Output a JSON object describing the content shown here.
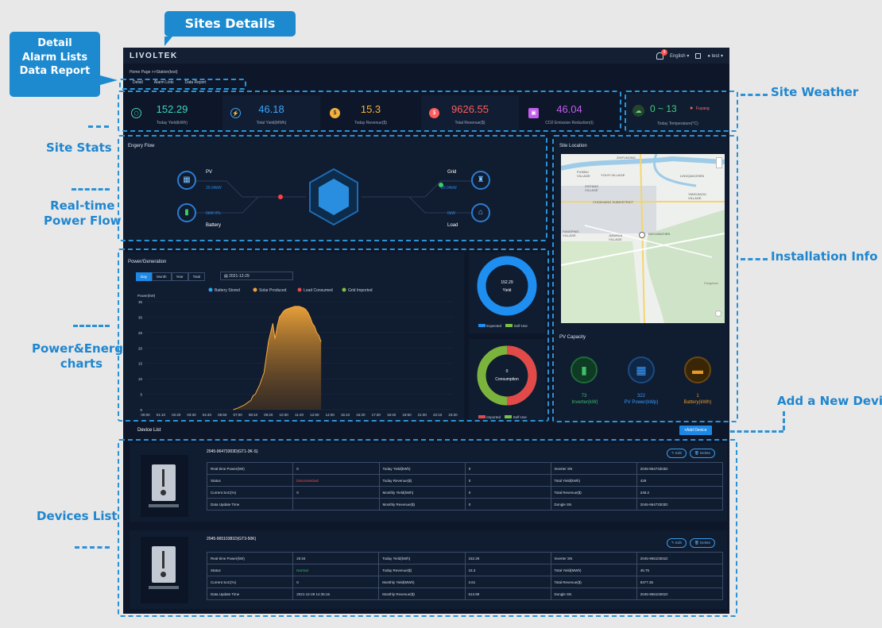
{
  "annotations": {
    "sites_details": "Sites Details",
    "detail_alarm": [
      "Detail",
      "Alarm Lists",
      "Data Report"
    ],
    "site_weather": "Site Weather",
    "site_stats": "Site Stats",
    "realtime_flow": [
      "Real-time",
      "Power Flow"
    ],
    "installation_info": "Installation Info",
    "power_energy": [
      "Power&Energy",
      "charts"
    ],
    "add_device": "Add a New Device",
    "devices_list": "Devices List"
  },
  "app": {
    "logo": "LIVOLTEK",
    "bell_count": "9",
    "language": "English",
    "user": "test",
    "breadcrumb": "Home Page >>Station(test)",
    "tabs": [
      "Detail",
      "Alarm Lists",
      "Data Report"
    ]
  },
  "stats": [
    {
      "value": "152.29",
      "label": "Today Yield(kWh)",
      "color": "#3bd3c0"
    },
    {
      "value": "46.18",
      "label": "Total Yield(MWh)",
      "color": "#3aa6ff"
    },
    {
      "value": "15.3",
      "label": "Today Revenue($)",
      "color": "#f5b23b"
    },
    {
      "value": "9626.55",
      "label": "Total Revenue($)",
      "color": "#ff5c5c"
    },
    {
      "value": "46.04",
      "label": "CO2 Emission Reduction(t)",
      "color": "#c45cf0"
    }
  ],
  "weather": {
    "value": "0 ~ 13",
    "city": "Fuyang",
    "label": "Today Temperature(°C)"
  },
  "energy_flow": {
    "title": "Engery Flow",
    "pv_label": "PV",
    "pv_value": "20.04kW",
    "battery_label": "Battery",
    "battery_value": "0kW 0%",
    "grid_label": "Grid",
    "grid_value": "20.04kW",
    "load_label": "Load",
    "load_value": "0kW"
  },
  "site_location": {
    "title": "Site Location",
    "places": [
      "ZHIFUNONG",
      "FUSIBU VILLAGE",
      "YOUYI VILLAGE",
      "LINGQIAOZHEN",
      "ZHITANG VILLAGE",
      "YANGJIAOLI VILLAGE",
      "CHUNJIANG SUBDISTRICT",
      "FANGPING VILLAGE",
      "JIANHUA VILLAGE",
      "DAYUANZHEN",
      "Fangchan"
    ]
  },
  "pv_capacity": {
    "title": "PV Capacity",
    "items": [
      {
        "value": "73",
        "label": "Inverter(kW)",
        "color": "#3fbf6a"
      },
      {
        "value": "322",
        "label": "PV Power(kWp)",
        "color": "#3a9bff"
      },
      {
        "value": "1",
        "label": "Battery(kWh)",
        "color": "#e79a24"
      }
    ]
  },
  "power_chart": {
    "title": "Power/Generation",
    "periods": [
      "Day",
      "Month",
      "Year",
      "Total"
    ],
    "date": "2021-12-29",
    "legend": [
      "Battery Stored",
      "Solar Produced",
      "Load Consumed",
      "Grid Imported"
    ],
    "legend_colors": [
      "#27a6f5",
      "#f0a23c",
      "#e24a4a",
      "#7cc043"
    ]
  },
  "chart_data": {
    "type": "area",
    "ylabel": "Power(kW)",
    "ylim": [
      0,
      35
    ],
    "yticks": [
      0,
      5,
      10,
      15,
      20,
      25,
      30,
      35
    ],
    "x_ticks": [
      "00:00",
      "01:10",
      "02:20",
      "03:30",
      "04:40",
      "05:50",
      "07:00",
      "08:10",
      "09:20",
      "10:30",
      "11:40",
      "12:50",
      "14:00",
      "15:10",
      "16:20",
      "17:30",
      "18:40",
      "19:50",
      "21:00",
      "22:10",
      "23:20"
    ],
    "series": [
      {
        "name": "Solar Produced",
        "x": [
          "06:40",
          "07:00",
          "07:30",
          "08:00",
          "08:10",
          "08:20",
          "08:40",
          "09:00",
          "09:10",
          "09:20",
          "09:30",
          "09:40",
          "09:50",
          "10:00",
          "10:10",
          "10:20",
          "10:30",
          "10:40",
          "11:00",
          "11:20",
          "11:40",
          "12:00",
          "12:10",
          "12:20",
          "12:30",
          "12:40",
          "12:50",
          "13:00",
          "13:10",
          "13:20"
        ],
        "values": [
          0,
          0.5,
          1.5,
          3,
          4.5,
          5,
          8,
          12,
          17,
          22,
          25,
          28,
          23,
          27,
          30,
          31,
          32,
          32.5,
          33,
          33.5,
          33.5,
          33,
          32.5,
          31.5,
          30,
          28,
          27,
          25,
          24,
          22
        ]
      }
    ]
  },
  "yield_donut": {
    "value": "152.29",
    "label": "Yield",
    "legend": [
      "Expected",
      "Self-Use"
    ]
  },
  "consumption_donut": {
    "value": "0",
    "label": "Consumption",
    "legend": [
      "Imported",
      "Self-Use"
    ]
  },
  "device_list": {
    "title": "Device List",
    "add_label": "+Add Device",
    "edit_label": "Edit",
    "delete_label": "Delete",
    "devices": [
      {
        "name": "2045-96473303D(GT1-3K-S)",
        "rows": [
          [
            "Real-time Power(kW)",
            "0",
            "Today Yield(kWh)",
            "0",
            "Inverter SN",
            "2045-96473303D"
          ],
          [
            "Status",
            "Disconnected",
            "Today Revenue($)",
            "0",
            "Total Yield(kWh)",
            "429"
          ],
          [
            "Current SoC(%)",
            "0",
            "Monthly Yield(kWh)",
            "0",
            "Total Revenue($)",
            "249.2"
          ],
          [
            "Data Update Time",
            "",
            "Monthly Revenue($)",
            "0",
            "Dongle SN",
            "2045-96473303D"
          ]
        ],
        "status_color": "#ff4d4d"
      },
      {
        "name": "2045-96510381D(GT3-50K)",
        "rows": [
          [
            "Real-time Power(kW)",
            "20.04",
            "Today Yield(kWh)",
            "152.29",
            "Inverter SN",
            "2045-96510381D"
          ],
          [
            "Status",
            "Normal",
            "Today Revenue($)",
            "15.3",
            "Total Yield(MWh)",
            "45.75"
          ],
          [
            "Current SoC(%)",
            "0",
            "Monthly Yield(MWh)",
            "3.61",
            "Total Revenue($)",
            "9377.35"
          ],
          [
            "Data Update Time",
            "2021-12-29 14:35:16",
            "Monthly Revenue($)",
            "513.99",
            "Dongle SN",
            "2045-96510381D"
          ]
        ],
        "status_color": "#3fbf6a"
      }
    ]
  }
}
